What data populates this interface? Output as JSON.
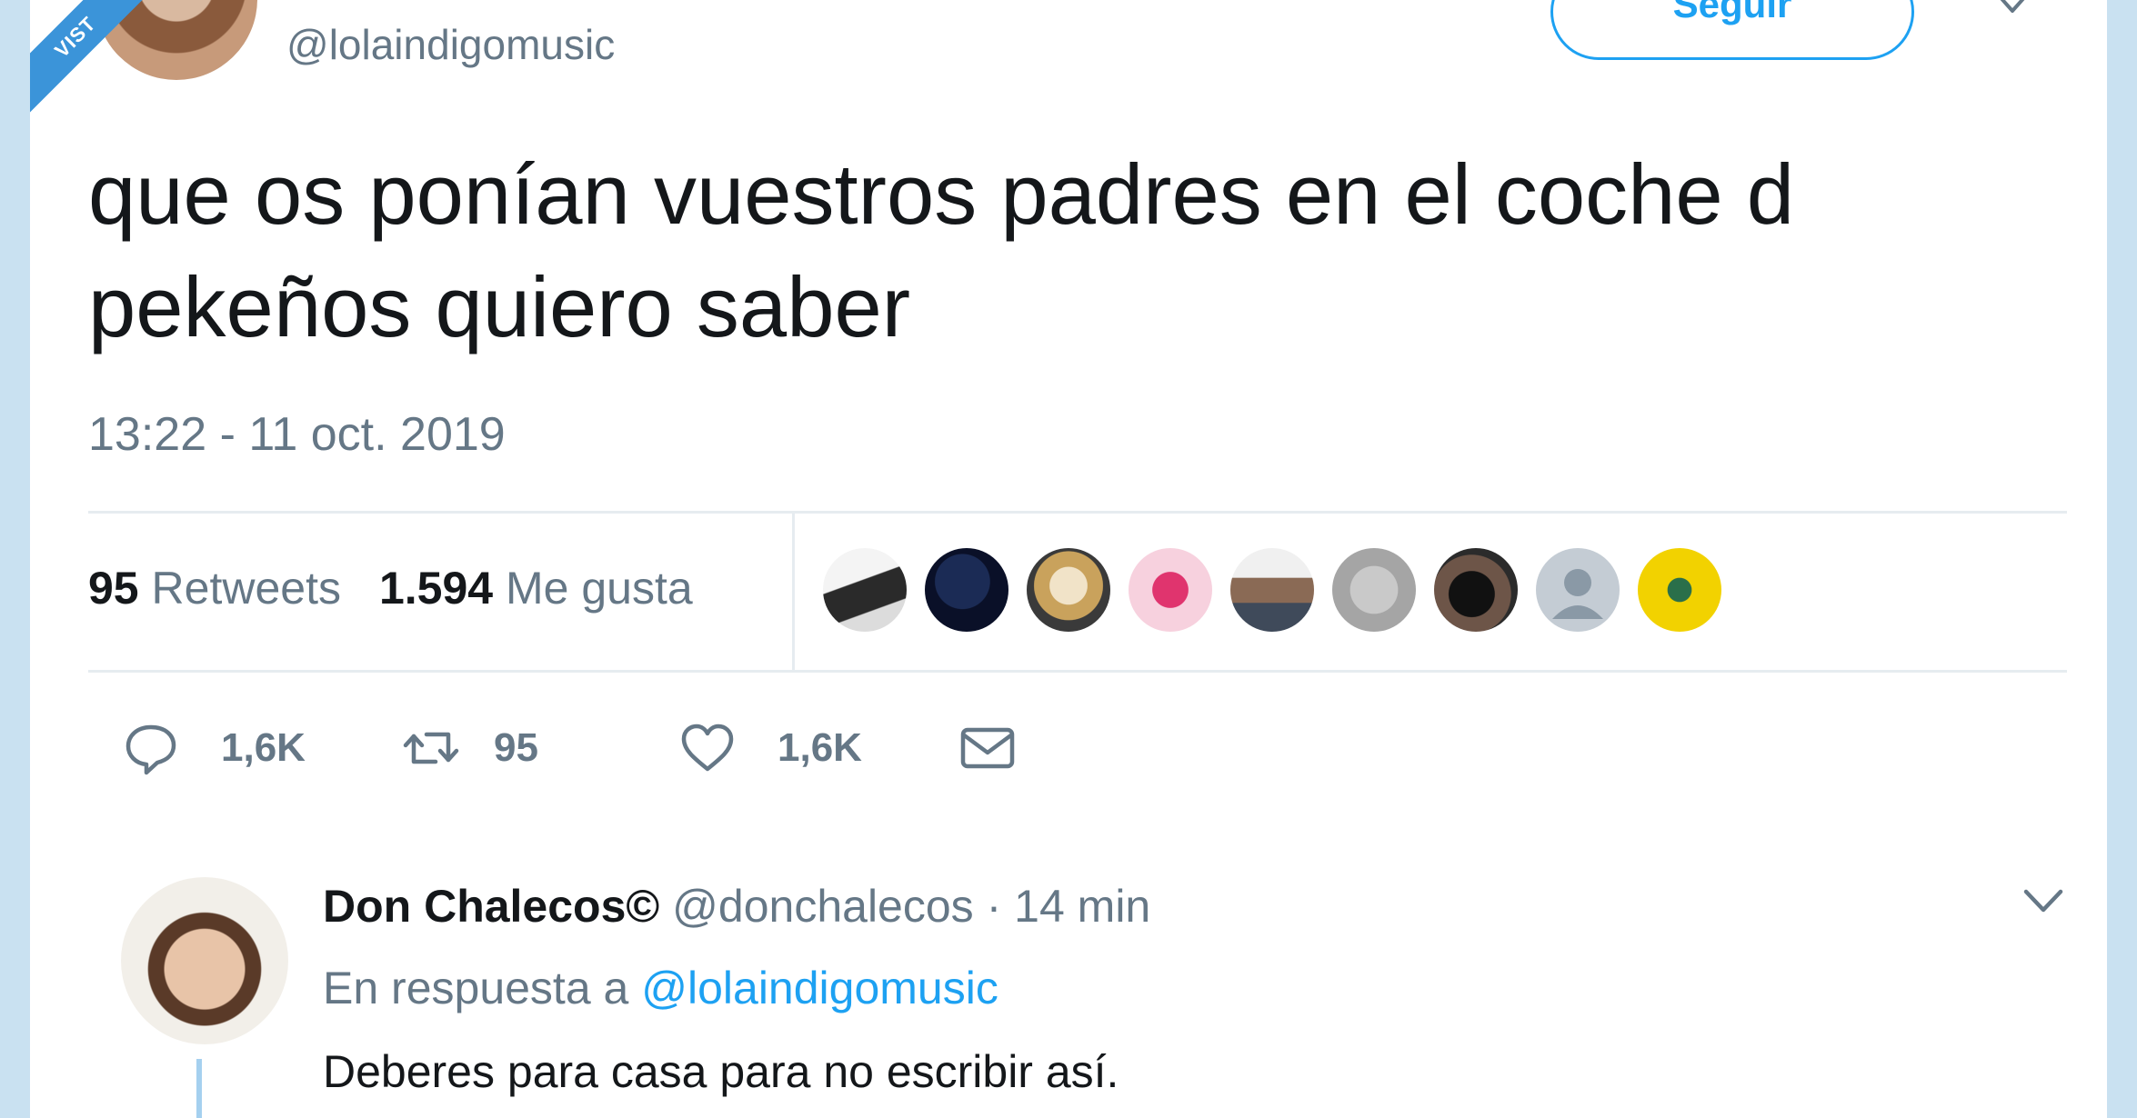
{
  "ribbon": {
    "text": "VIST"
  },
  "tweet": {
    "handle": "@lolaindigomusic",
    "follow_label": "Seguir",
    "text": "que os ponían vuestros padres en el coche d pekeños quiero saber",
    "timestamp": "13:22 - 11 oct. 2019",
    "stats": {
      "retweets_count": "95",
      "retweets_label": "Retweets",
      "likes_count": "1.594",
      "likes_label": "Me gusta"
    },
    "likers": [
      "liker-1",
      "liker-2",
      "liker-3",
      "liker-4",
      "liker-5",
      "liker-6",
      "liker-7",
      "liker-8",
      "liker-9"
    ],
    "actions": {
      "replies": "1,6K",
      "retweets": "95",
      "likes": "1,6K"
    }
  },
  "reply": {
    "name": "Don Chalecos©",
    "handle": "@donchalecos",
    "separator": "·",
    "time": "14 min",
    "in_reply_to_label": "En respuesta a",
    "in_reply_to_handle": "@lolaindigomusic",
    "text": "Deberes para casa para no escribir así."
  },
  "colors": {
    "background": "#c9e1f1",
    "card": "#ffffff",
    "accent": "#1da1f2",
    "secondary_text": "#657786",
    "primary_text": "#14171a"
  }
}
